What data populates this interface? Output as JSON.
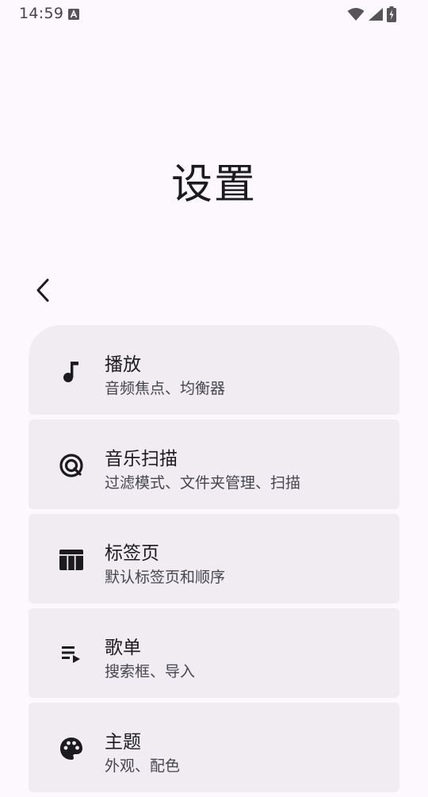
{
  "status_bar": {
    "time": "14:59",
    "notification_icon": "a-icon",
    "wifi_icon": "wifi-icon",
    "signal_icon": "signal-icon",
    "battery_icon": "battery-charging-icon"
  },
  "header": {
    "title": "设置",
    "back_icon": "chevron-left-icon"
  },
  "settings": {
    "items": [
      {
        "title": "播放",
        "subtitle": "音频焦点、均衡器",
        "icon": "music-note-icon"
      },
      {
        "title": "音乐扫描",
        "subtitle": "过滤模式、文件夹管理、扫描",
        "icon": "album-scan-icon"
      },
      {
        "title": "标签页",
        "subtitle": "默认标签页和顺序",
        "icon": "tab-layout-icon"
      },
      {
        "title": "歌单",
        "subtitle": "搜索框、导入",
        "icon": "playlist-play-icon"
      },
      {
        "title": "主题",
        "subtitle": "外观、配色",
        "icon": "palette-icon"
      }
    ]
  },
  "colors": {
    "background": "#fcf8fe",
    "card": "#f0ecf2",
    "text_primary": "#1b1b1f",
    "text_secondary": "#46464f"
  }
}
